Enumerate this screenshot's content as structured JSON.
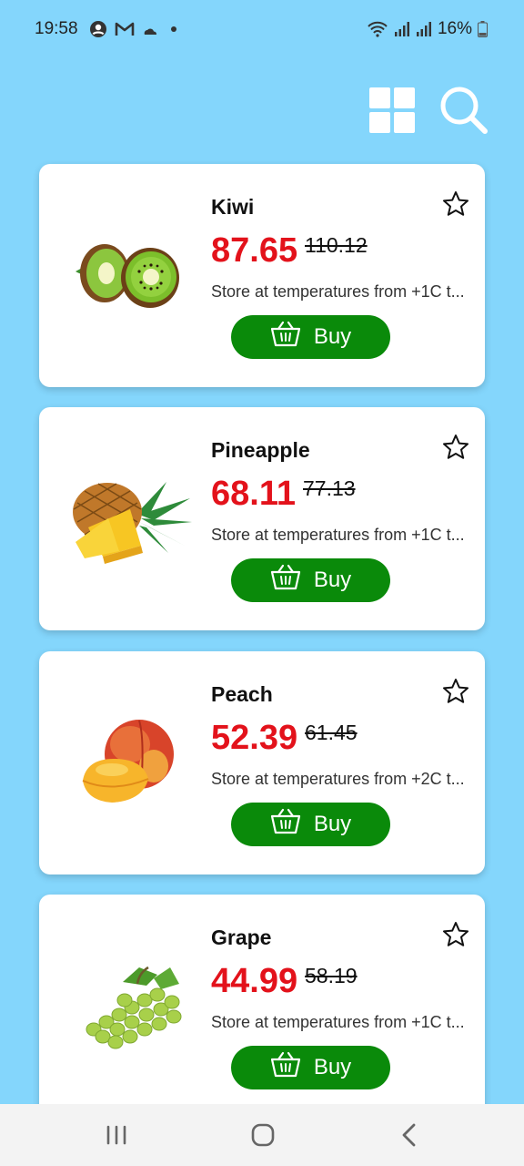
{
  "status_bar": {
    "time": "19:58",
    "battery": "16%",
    "icons": [
      "account-icon",
      "gmail-icon",
      "cloud-moon-icon",
      "dot-icon",
      "wifi-icon",
      "signal-icon",
      "signal-icon",
      "battery-icon"
    ]
  },
  "toolbar": {
    "grid_icon": "grid-view-icon",
    "search_icon": "search-icon"
  },
  "products": [
    {
      "name": "Kiwi",
      "price": "87.65",
      "old_price": "110.12",
      "description": "Store at temperatures from +1C t...",
      "buy_label": "Buy",
      "image": "kiwi-image"
    },
    {
      "name": "Pineapple",
      "price": "68.11",
      "old_price": "77.13",
      "description": "Store at temperatures from +1C t...",
      "buy_label": "Buy",
      "image": "pineapple-image"
    },
    {
      "name": "Peach",
      "price": "52.39",
      "old_price": "61.45",
      "description": "Store at temperatures from +2C t...",
      "buy_label": "Buy",
      "image": "peach-image"
    },
    {
      "name": "Grape",
      "price": "44.99",
      "old_price": "58.19",
      "description": "Store at temperatures from +1C t...",
      "buy_label": "Buy",
      "image": "grape-image"
    }
  ],
  "colors": {
    "background": "#84D6FC",
    "price": "#E3121B",
    "buy_button": "#0A8A0A"
  },
  "nav_bar": {
    "icons": [
      "recent-apps-icon",
      "home-icon",
      "back-icon"
    ]
  }
}
